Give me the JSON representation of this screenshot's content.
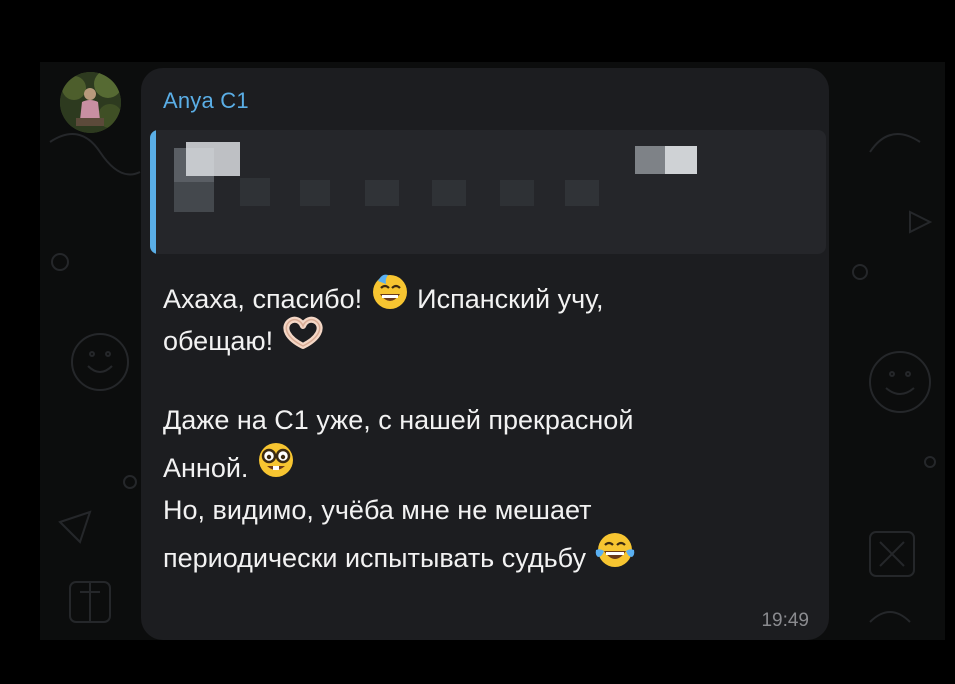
{
  "message": {
    "sender": "Anya C1",
    "paragraph1": {
      "line1_a": "Ахаха, спасибо!",
      "line1_emoji": "sweat-smile-emoji",
      "line1_b": "Испанский учу,",
      "line2": "обещаю!",
      "line2_emoji": "heart-hands-emoji"
    },
    "paragraph2": {
      "line1": "Даже на С1 уже, с нашей прекрасной",
      "line2": "Анной.",
      "line2_emoji": "nerd-face-emoji",
      "line3": "Но, видимо, учёба мне не мешает",
      "line4": "периодически испытывать судьбу",
      "line4_emoji": "tears-of-joy-emoji"
    },
    "time": "19:49"
  },
  "colors": {
    "sender": "#5aaee6",
    "bubble": "#1c1d20",
    "reply_background": "#25262a",
    "text": "#f2f2f2",
    "time": "#8a8b8f"
  }
}
